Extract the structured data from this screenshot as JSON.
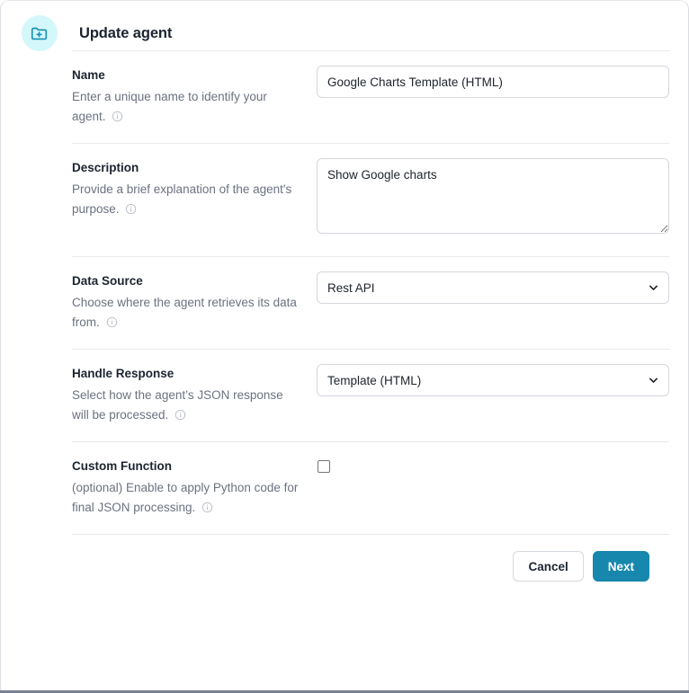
{
  "header": {
    "title": "Update agent",
    "icon": "folder-plus-icon",
    "icon_color": "#1792b5",
    "icon_bg": "#d4f7fb"
  },
  "theme": {
    "accent": "#1787ad",
    "text": "#1c2430",
    "muted": "#6b7280",
    "border": "#d5d8de",
    "divider": "#e9eaed"
  },
  "form": {
    "name": {
      "label": "Name",
      "description": "Enter a unique name to identify your agent.",
      "info_icon": "info-icon",
      "value": "Google Charts Template (HTML)",
      "placeholder": ""
    },
    "description": {
      "label": "Description",
      "description": "Provide a brief explanation of the agent's purpose.",
      "info_icon": "info-icon",
      "value": "Show Google charts",
      "placeholder": ""
    },
    "data_source": {
      "label": "Data Source",
      "description": "Choose where the agent retrieves its data from.",
      "info_icon": "info-icon",
      "selected": "Rest API",
      "options": [
        "Rest API"
      ]
    },
    "handle_response": {
      "label": "Handle Response",
      "description": "Select how the agent’s JSON response will be processed.",
      "info_icon": "info-icon",
      "selected": "Template (HTML)",
      "options": [
        "Template (HTML)"
      ]
    },
    "custom_function": {
      "label": "Custom Function",
      "description": "(optional) Enable to apply Python code for final JSON processing.",
      "info_icon": "info-icon",
      "checked": false
    }
  },
  "footer": {
    "cancel_label": "Cancel",
    "next_label": "Next"
  }
}
